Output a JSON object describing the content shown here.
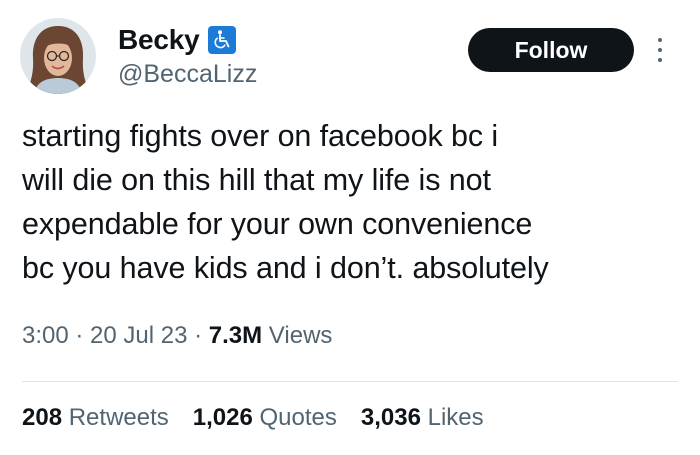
{
  "user": {
    "display_name": "Becky",
    "handle": "@BeccaLizz",
    "badge_icon": "wheelchair-icon",
    "badge_color": "#1d7bd8"
  },
  "follow_button": {
    "label": "Follow"
  },
  "tweet": {
    "text": "starting fights over on facebook bc i\nwill die on this hill that my life is not\nexpendable for your own convenience\nbc you have kids and i don’t. absolutely"
  },
  "meta": {
    "time": "3:00",
    "separator": " · ",
    "date": "20 Jul 23",
    "views_count": "7.3M",
    "views_label": " Views"
  },
  "stats": {
    "retweets_count": "208",
    "retweets_label": " Retweets",
    "quotes_count": "1,026",
    "quotes_label": " Quotes",
    "likes_count": "3,036",
    "likes_label": " Likes"
  },
  "colors": {
    "text_primary": "#0f1419",
    "text_secondary": "#536471",
    "button_bg": "#0f1419",
    "divider": "#dfe4e8"
  }
}
